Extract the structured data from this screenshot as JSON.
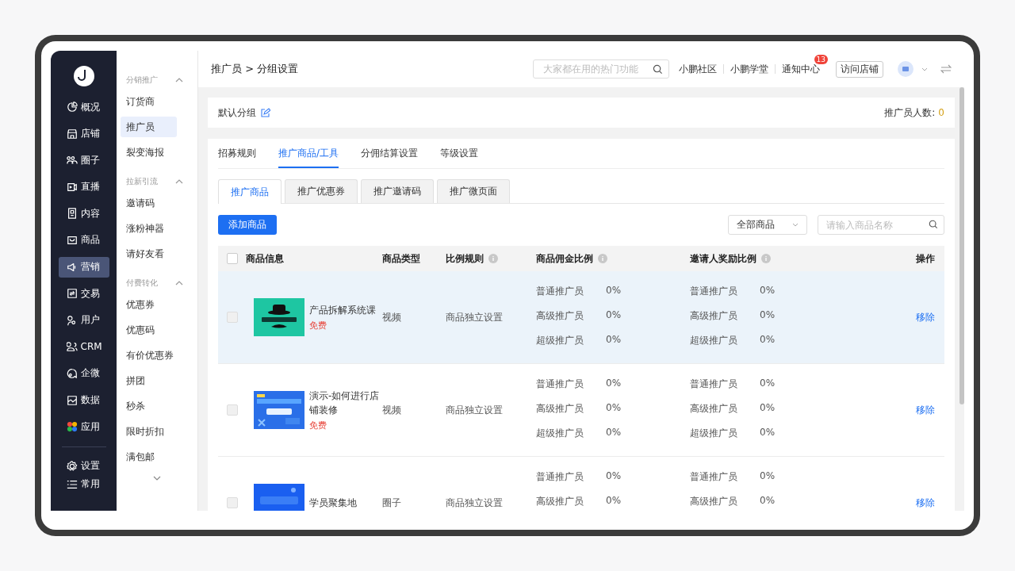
{
  "main_nav": [
    {
      "label": "概况",
      "selected": false
    },
    {
      "label": "店铺",
      "selected": false
    },
    {
      "label": "圈子",
      "selected": false
    },
    {
      "label": "直播",
      "selected": false
    },
    {
      "label": "内容",
      "selected": false
    },
    {
      "label": "商品",
      "selected": false
    },
    {
      "label": "营销",
      "selected": true
    },
    {
      "label": "交易",
      "selected": false
    },
    {
      "label": "用户",
      "selected": false
    },
    {
      "label": "CRM",
      "selected": false
    },
    {
      "label": "企微",
      "selected": false
    },
    {
      "label": "数据",
      "selected": false
    },
    {
      "label": "应用",
      "selected": false
    }
  ],
  "bottom_nav": [
    {
      "label": "设置"
    },
    {
      "label": "常用"
    }
  ],
  "submenu": [
    {
      "title": "分销推广",
      "expanded": true,
      "items": [
        {
          "label": "订货商",
          "selected": false
        },
        {
          "label": "推广员",
          "selected": true
        },
        {
          "label": "裂变海报",
          "selected": false
        }
      ]
    },
    {
      "title": "拉新引流",
      "expanded": true,
      "items": [
        {
          "label": "邀请码",
          "selected": false
        },
        {
          "label": "涨粉神器",
          "selected": false
        },
        {
          "label": "请好友看",
          "selected": false
        }
      ]
    },
    {
      "title": "付费转化",
      "expanded": true,
      "items": [
        {
          "label": "优惠券",
          "selected": false
        },
        {
          "label": "优惠码",
          "selected": false
        },
        {
          "label": "有价优惠券",
          "selected": false
        },
        {
          "label": "拼团",
          "selected": false
        },
        {
          "label": "秒杀",
          "selected": false
        },
        {
          "label": "限时折扣",
          "selected": false
        },
        {
          "label": "满包邮",
          "selected": false
        }
      ]
    }
  ],
  "header": {
    "breadcrumb": "推广员 > 分组设置",
    "search": {
      "placeholder": "大家都在用的热门功能"
    },
    "links": [
      {
        "label": "小鹏社区"
      },
      {
        "label": "小鹏学堂"
      },
      {
        "label": "通知中心",
        "badge": "13"
      }
    ],
    "visit_button": "访问店铺"
  },
  "group_card": {
    "name": "默认分组",
    "count_label": "推广员人数:",
    "count": "0"
  },
  "tabs": [
    {
      "label": "招募规则",
      "selected": false
    },
    {
      "label": "推广商品/工具",
      "selected": true
    },
    {
      "label": "分佣结算设置",
      "selected": false
    },
    {
      "label": "等级设置",
      "selected": false
    }
  ],
  "subtabs": [
    {
      "label": "推广商品",
      "selected": true
    },
    {
      "label": "推广优惠券",
      "selected": false
    },
    {
      "label": "推广邀请码",
      "selected": false
    },
    {
      "label": "推广微页面",
      "selected": false
    }
  ],
  "toolbar": {
    "add_button": "添加商品",
    "filter": {
      "value": "全部商品"
    },
    "search": {
      "placeholder": "请输入商品名称"
    }
  },
  "table": {
    "checked": false,
    "columns": [
      {
        "label": "商品信息",
        "info": false
      },
      {
        "label": "商品类型",
        "info": false
      },
      {
        "label": "比例规则",
        "info": true
      },
      {
        "label": "商品佣金比例",
        "info": true
      },
      {
        "label": "邀请人奖励比例",
        "info": true
      },
      {
        "label": "操作",
        "info": false
      }
    ],
    "rows": [
      {
        "checked": false,
        "hovered": true,
        "title": "产品拆解系统课",
        "price": "免费",
        "type": "视频",
        "rule": "商品独立设置",
        "commission": [
          {
            "level": "普通推广员",
            "rate": "0%"
          },
          {
            "level": "高级推广员",
            "rate": "0%"
          },
          {
            "level": "超级推广员",
            "rate": "0%"
          }
        ],
        "invite": [
          {
            "level": "普通推广员",
            "rate": "0%"
          },
          {
            "level": "高级推广员",
            "rate": "0%"
          },
          {
            "level": "超级推广员",
            "rate": "0%"
          }
        ],
        "action": "移除"
      },
      {
        "checked": false,
        "hovered": false,
        "title": "演示-如何进行店铺装修",
        "price": "免费",
        "type": "视频",
        "rule": "商品独立设置",
        "commission": [
          {
            "level": "普通推广员",
            "rate": "0%"
          },
          {
            "level": "高级推广员",
            "rate": "0%"
          },
          {
            "level": "超级推广员",
            "rate": "0%"
          }
        ],
        "invite": [
          {
            "level": "普通推广员",
            "rate": "0%"
          },
          {
            "level": "高级推广员",
            "rate": "0%"
          },
          {
            "level": "超级推广员",
            "rate": "0%"
          }
        ],
        "action": "移除"
      },
      {
        "checked": false,
        "hovered": false,
        "title": "学员聚集地",
        "type": "圈子",
        "rule": "商品独立设置",
        "commission": [
          {
            "level": "普通推广员",
            "rate": "0%"
          },
          {
            "level": "高级推广员",
            "rate": "0%"
          }
        ],
        "invite": [
          {
            "level": "普通推广员",
            "rate": "0%"
          },
          {
            "level": "高级推广员",
            "rate": "0%"
          }
        ],
        "action": "移除"
      }
    ]
  }
}
